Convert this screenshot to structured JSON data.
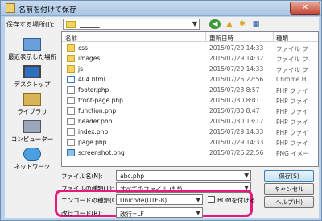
{
  "window": {
    "title": "名前を付けて保存",
    "close_label": "✕"
  },
  "toolbar": {
    "save_in_label": "保存する場所(I):",
    "location_value": "▁▁▁▁",
    "icons": [
      "back-icon",
      "up-folder-icon",
      "new-folder-icon",
      "views-icon"
    ]
  },
  "places": [
    {
      "label": "最近表示した場所",
      "icon": "recent-places-icon"
    },
    {
      "label": "デスクトップ",
      "icon": "desktop-icon"
    },
    {
      "label": "ライブラリ",
      "icon": "library-icon"
    },
    {
      "label": "コンピューター",
      "icon": "computer-icon"
    },
    {
      "label": "ネットワーク",
      "icon": "network-icon"
    }
  ],
  "filelist": {
    "columns": {
      "name": "名前",
      "date": "更新日時",
      "type": "種類"
    },
    "rows": [
      {
        "name": "css",
        "date": "2015/07/29 14:33",
        "type": "ファイル フ",
        "kind": "folder"
      },
      {
        "name": "images",
        "date": "2015/07/29 14:32",
        "type": "ファイル フ",
        "kind": "folder"
      },
      {
        "name": "js",
        "date": "2015/07/29 14:33",
        "type": "ファイル フ",
        "kind": "folder"
      },
      {
        "name": "404.html",
        "date": "2015/07/26 22:56",
        "type": "Chrome H",
        "kind": "html"
      },
      {
        "name": "footer.php",
        "date": "2015/07/28 8:57",
        "type": "PHP ファイ",
        "kind": "php"
      },
      {
        "name": "front-page.php",
        "date": "2015/07/30 8:01",
        "type": "PHP ファイ",
        "kind": "php"
      },
      {
        "name": "function.php",
        "date": "2015/07/30 8:47",
        "type": "PHP ファイ",
        "kind": "php"
      },
      {
        "name": "header.php",
        "date": "2015/07/30 13:12",
        "type": "PHP ファイ",
        "kind": "php"
      },
      {
        "name": "index.php",
        "date": "2015/07/29 14:33",
        "type": "PHP ファイ",
        "kind": "php"
      },
      {
        "name": "page.php",
        "date": "2015/07/29 14:33",
        "type": "PHP ファイ",
        "kind": "php"
      },
      {
        "name": "screenshot.png",
        "date": "2015/07/26 22:56",
        "type": "PNG イメー",
        "kind": "png"
      }
    ]
  },
  "form": {
    "filename_label": "ファイル名(N):",
    "filename_value": "abc.php",
    "filetype_label": "ファイルの種類(T):",
    "filetype_value": "すべてのファイル (*.*)",
    "encoding_label": "エンコードの種類(C):",
    "encoding_value": "Unicode(UTF-8)",
    "bom_label": "BOMを付ける",
    "bom_checked": false,
    "linebreak_label": "改行コード(R):",
    "linebreak_value": "改行=LF"
  },
  "buttons": {
    "save": "保存(S)",
    "cancel": "キャンセル",
    "help": "ヘルプ(H)"
  },
  "colors": {
    "highlight": "#e6197f",
    "chrome": "#b9d1ea"
  }
}
